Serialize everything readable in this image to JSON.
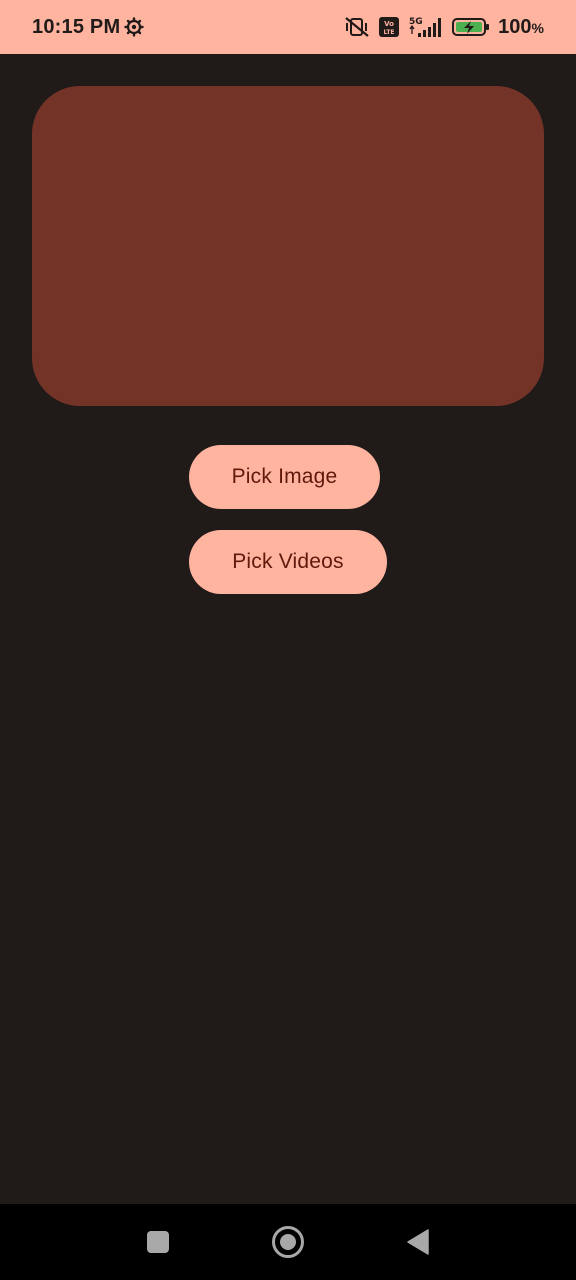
{
  "status_bar": {
    "time": "10:15 PM",
    "battery_value": "100",
    "battery_unit": "%",
    "icons": [
      "settings-gear-icon",
      "vibrate-off-icon",
      "volte-icon",
      "5g-signal-icon",
      "battery-charging-icon"
    ],
    "network_label": "5G",
    "volte_label": "Vo LTE"
  },
  "main": {
    "buttons": {
      "pick_image": "Pick Image",
      "pick_videos": "Pick Videos"
    }
  },
  "nav_bar": {
    "icons": [
      "recents-icon",
      "home-icon",
      "back-icon"
    ]
  },
  "colors": {
    "status_bar_bg": "#ffb4a0",
    "background": "#201a18",
    "preview_card": "#733427",
    "button_bg": "#ffb4a0",
    "button_text": "#5f1a0c",
    "battery_fill": "#4caf50"
  }
}
